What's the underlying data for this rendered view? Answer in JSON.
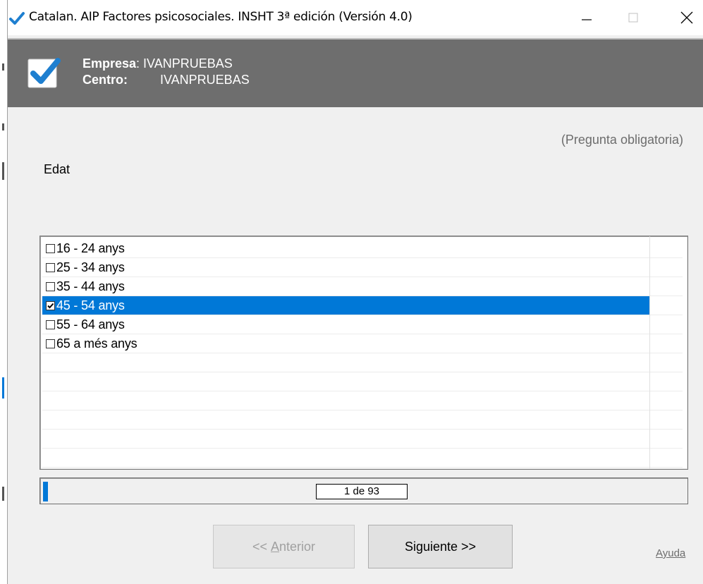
{
  "window": {
    "title": "Catalan. AIP Factores psicosociales. INSHT 3ª edición (Versión 4.0)"
  },
  "header": {
    "empresa_label": "Empresa",
    "empresa_value": ": IVANPRUEBAS",
    "centro_label": "Centro:",
    "centro_value": "IVANPRUEBAS",
    "background_color": "#6e6e6e"
  },
  "question": {
    "mandatory_note": "(Pregunta obligatoria)",
    "text": "Edat"
  },
  "options": [
    {
      "label": "16 - 24 anys",
      "checked": false,
      "selected": false
    },
    {
      "label": "25 - 34 anys",
      "checked": false,
      "selected": false
    },
    {
      "label": "35 - 44 anys",
      "checked": false,
      "selected": false
    },
    {
      "label": "45 - 54  anys",
      "checked": true,
      "selected": true
    },
    {
      "label": "55 - 64 anys",
      "checked": false,
      "selected": false
    },
    {
      "label": "65 a més anys",
      "checked": false,
      "selected": false
    }
  ],
  "progress": {
    "counter_text": "1 de 93",
    "current": 1,
    "total": 93
  },
  "buttons": {
    "prev_prefix": "<< ",
    "prev_accel": "A",
    "prev_rest": "nterior",
    "prev_enabled": false,
    "next_label": "Siguiente >>",
    "help_label": "Ayuda"
  },
  "colors": {
    "accent": "#0078d7",
    "header_text": "#ffffff",
    "muted_text": "#6d6d6d"
  },
  "icons": {
    "app": "checkmark-icon",
    "minimize": "minimize-icon",
    "maximize": "maximize-icon",
    "close": "close-icon"
  }
}
